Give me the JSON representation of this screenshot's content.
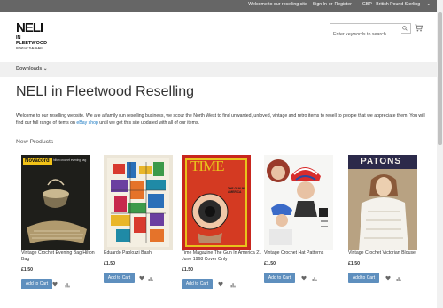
{
  "topbar": {
    "welcome": "Welcome to our reselling site",
    "sign_in": "Sign In",
    "or": "or",
    "register": "Register",
    "currency": "GBP - British Pound Sterling"
  },
  "logo": {
    "line1": "NELI",
    "line2": "IN FLEETWOOD",
    "line3": "DOWN AT THE SHED"
  },
  "search": {
    "placeholder": "Enter keywords to search..."
  },
  "nav": {
    "downloads": "Downloads"
  },
  "page": {
    "title": "NELI in Fleetwood Reselling",
    "intro_part1": "Welcome to our reselling website. We are a family run reselling business, we scour the North West to find unwanted, unloved, vintage and retro items to resell to people that we appreciate them. You will find our full range of items on ",
    "intro_link": "eBay shop",
    "intro_part2": " until we get this site updated with all of our items.",
    "section_title": "New Products"
  },
  "products": [
    {
      "name": "Vintage Crochet Evening Bag Hilton Bag",
      "price": "£1.50",
      "add_to_cart": "Add to Cart",
      "image_text": "Novacord",
      "image_subtext": "hilton crochet evening bag"
    },
    {
      "name": "Eduardo Paolozzi Bash",
      "price": "£1.50",
      "add_to_cart": "Add to Cart"
    },
    {
      "name": "Time Magazine The Gun In America 21 June 1968 Cover Only",
      "price": "£1.50",
      "add_to_cart": "Add to Cart",
      "image_text": "TIME",
      "image_subtext": "THE GUN IN AMERICA"
    },
    {
      "name": "Vintage Crochet Hat Patterns",
      "price": "£1.50",
      "add_to_cart": "Add to Cart"
    },
    {
      "name": "Vintage Crochet Victorian Blouse",
      "price": "£1.50",
      "add_to_cart": "Add to Cart",
      "image_text": "PATONS"
    }
  ],
  "colors": {
    "topbar": "#666666",
    "button": "#5e8fbe",
    "link": "#1979c3",
    "nav": "#f0f0f0"
  }
}
